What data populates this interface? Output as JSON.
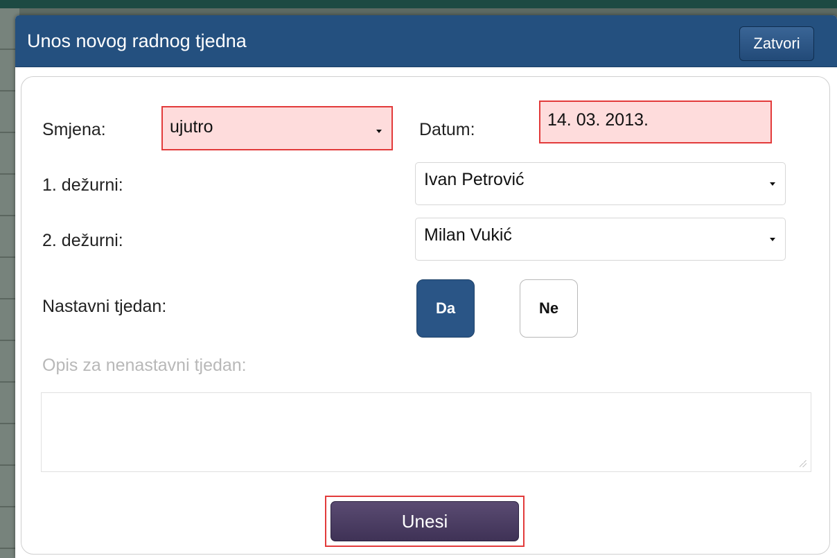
{
  "dialog": {
    "title": "Unos novog radnog tjedna",
    "close_label": "Zatvori"
  },
  "form": {
    "shift": {
      "label": "Smjena:",
      "value": "ujutro"
    },
    "date": {
      "label": "Datum:",
      "value": "14. 03. 2013."
    },
    "duty1": {
      "label": "1. dežurni:",
      "value": "Ivan Petrović"
    },
    "duty2": {
      "label": "2. dežurni:",
      "value": "Milan Vukić"
    },
    "teaching_week": {
      "label": "Nastavni tjedan:",
      "yes": "Da",
      "no": "Ne",
      "selected": "Da"
    },
    "description": {
      "label": "Opis za nenastavni tjedan:",
      "value": ""
    },
    "submit_label": "Unesi"
  },
  "colors": {
    "titlebar": "#24507f",
    "active_toggle": "#2a5586",
    "submit": "#4a3c62",
    "invalid_bg": "#fedcdc",
    "invalid_border": "#e23a3a"
  }
}
